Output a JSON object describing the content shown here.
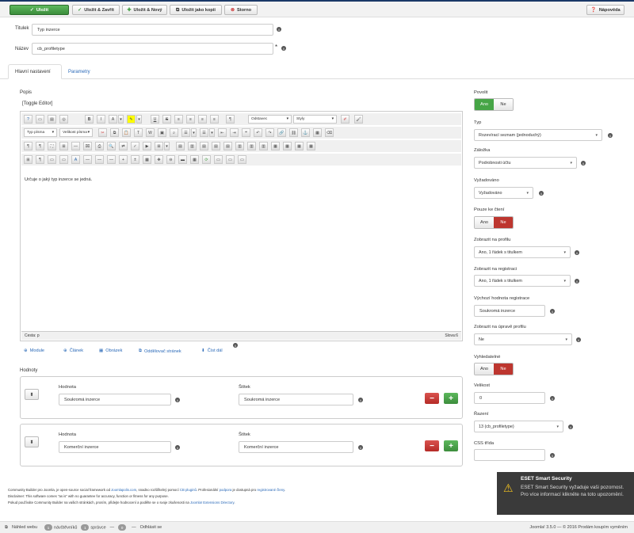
{
  "toolbar": {
    "save": "Uložit",
    "save_close": "Uložit & Zavřít",
    "save_new": "Uložit & Nový",
    "save_copy": "Uložit jako kopii",
    "cancel": "Storno",
    "help": "Nápověda"
  },
  "form": {
    "title_label": "Titulek",
    "title_value": "Typ inzerce",
    "name_label": "Název",
    "name_value": "cb_profiletype",
    "required_mark": "*"
  },
  "tabs": [
    {
      "label": "Hlavní nastavení"
    },
    {
      "label": "Parametry"
    }
  ],
  "editor": {
    "label": "Popis",
    "toggle": "[Toggle Editor]",
    "format_select": "Odstavec",
    "styles_select": "Styly",
    "font_select": "Typ písma",
    "size_select": "Velikost písma",
    "content": "Určuje o jaký typ inzerce se jedná.",
    "path": "Cesta: p",
    "wordcount": "Slova:6",
    "buttons": [
      "Module",
      "Článek",
      "Obrázek",
      "Oddělovač stránek",
      "Číst dál"
    ]
  },
  "values": {
    "label": "Hodnoty",
    "rows": [
      {
        "value_label": "Hodnota",
        "value": "Soukromá inzerce",
        "tag_label": "Štítek",
        "tag": "Soukromá inzerce"
      },
      {
        "value_label": "Hodnota",
        "value": "Komerční inzerce",
        "tag_label": "Štítek",
        "tag": "Komerční inzerce"
      }
    ]
  },
  "side": {
    "enabled_label": "Povolit",
    "yes": "Ano",
    "no": "Ne",
    "type_label": "Typ",
    "type_value": "Rozevírací seznam (jednoduchý)",
    "tab_label": "Záložka",
    "tab_value": "Podrobnosti účtu",
    "required_label": "Vyžadováno",
    "required_value": "Vyžadováno",
    "readonly_label": "Pouze ke čtení",
    "profile_label": "Zobrazit na profilu",
    "profile_value": "Ano, 1 řádek s titulkem",
    "registration_label": "Zobrazit na registraci",
    "registration_value": "Ano, 1 řádek s titulkem",
    "default_label": "Výchozí hodnota registrace",
    "default_value": "Soukromá inzerce",
    "edit_label": "Zobrazit na úpravě profilu",
    "edit_value": "Ne",
    "searchable_label": "Vyhledatelné",
    "size_label": "Velikost",
    "size_value": "0",
    "order_label": "Řazení",
    "order_value": "13 (cb_profiletype)",
    "css_label": "CSS třída",
    "css_value": ""
  },
  "footer": {
    "line1_a": "Community Builder pro Joomla, je open-source social framework od ",
    "line1_link1": "Joomlapolis.com",
    "line1_b": ", snadno rozšiřitelný pomocí ",
    "line1_link2": "CB pluginů",
    "line1_c": ". Profesionální ",
    "line1_link3": "podpora",
    "line1_d": " je dostupná pro ",
    "line1_link4": "registrované členy",
    "line1_e": ".",
    "line2": "Disclaimer: This software comes \"as is\" with no guarantee for accuracy, function or fitness for any purpose.",
    "line3_a": "Pokud používáte Community Builder na vašich stránkách, prosím, přidejte hodnocení a podělte se o svoje zkušenosti na ",
    "line3_link": "Joomla! Extensions Directory",
    "line3_b": "."
  },
  "statusbar": {
    "view_site": "Náhled webu",
    "visitors_count": "1",
    "visitors": "návštěvníků",
    "admins_count": "1",
    "admins": "správce",
    "msgs_count": "0",
    "logout": "Odhlásit se",
    "version": "Joomla! 3.5.0 — © 2016 Prodám koupím vyměním"
  },
  "eset": {
    "title": "ESET Smart Security",
    "message": "ESET Smart Security vyžaduje vaši pozornost. Pro více informací klikněte na toto upozornění."
  }
}
